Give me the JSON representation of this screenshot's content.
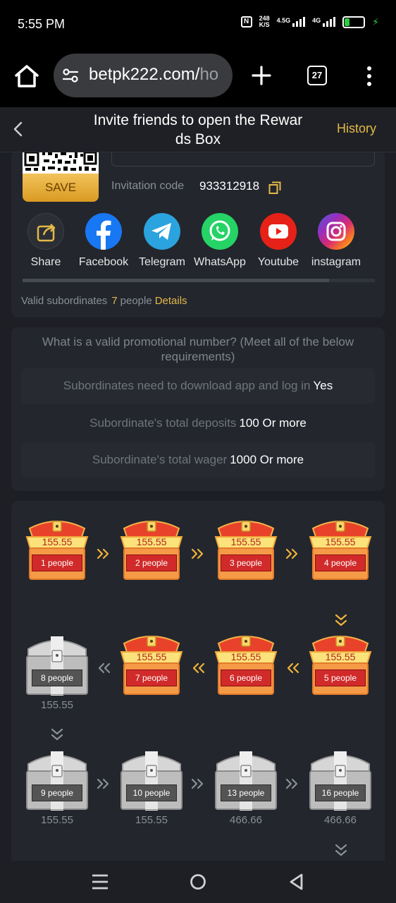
{
  "status_bar": {
    "time": "5:55 PM",
    "speed_value": "248",
    "speed_unit": "K/S",
    "signal1": "4.5G",
    "signal2": "4G",
    "battery": "28",
    "battery_percent": 28
  },
  "browser": {
    "url_main": "betpk222.com/",
    "url_rest": "ho",
    "tab_count": "27"
  },
  "header": {
    "title_line1": "Invite friends to open the Rewar",
    "title_line2": "ds Box",
    "history_label": "History"
  },
  "invite": {
    "save_label": "SAVE",
    "code_label": "Invitation code",
    "code_value": "933312918",
    "share_items": [
      {
        "label": "Share",
        "icon": "share-icon",
        "color": "#2b2e35"
      },
      {
        "label": "Facebook",
        "icon": "facebook-icon",
        "color": "#1877f2"
      },
      {
        "label": "Telegram",
        "icon": "telegram-icon",
        "color": "#2aa3de"
      },
      {
        "label": "WhatsApp",
        "icon": "whatsapp-icon",
        "color": "#25d366"
      },
      {
        "label": "Youtube",
        "icon": "youtube-icon",
        "color": "#e62117"
      },
      {
        "label": "instagram",
        "icon": "instagram-icon",
        "color": "#d62976"
      }
    ],
    "share_scroll_fraction": 0.87,
    "valid_label": "Valid subordinates",
    "valid_count": "7",
    "valid_unit": "people",
    "details_label": "Details"
  },
  "requirements": {
    "title": "What is a valid promotional number? (Meet all of the below requirements)",
    "rows": [
      {
        "label": "Subordinates need to download app and log in",
        "value": "Yes"
      },
      {
        "label": "Subordinate's total deposits",
        "value": "100 Or more"
      },
      {
        "label": "Subordinate's total wager",
        "value": "1000 Or more"
      }
    ]
  },
  "chests": [
    {
      "people": "1 people",
      "amount": "155.55",
      "opened": true
    },
    {
      "people": "2 people",
      "amount": "155.55",
      "opened": true
    },
    {
      "people": "3 people",
      "amount": "155.55",
      "opened": true
    },
    {
      "people": "4 people",
      "amount": "155.55",
      "opened": true
    },
    {
      "people": "5 people",
      "amount": "155.55",
      "opened": true
    },
    {
      "people": "6 people",
      "amount": "155.55",
      "opened": true
    },
    {
      "people": "7 people",
      "amount": "155.55",
      "opened": true
    },
    {
      "people": "8 people",
      "amount": "155.55",
      "opened": false
    },
    {
      "people": "9 people",
      "amount": "155.55",
      "opened": false
    },
    {
      "people": "10 people",
      "amount": "155.55",
      "opened": false
    },
    {
      "people": "13 people",
      "amount": "466.66",
      "opened": false
    },
    {
      "people": "16 people",
      "amount": "466.66",
      "opened": false
    }
  ],
  "colors": {
    "accent": "#e3b948",
    "background": "#1d1f25",
    "card": "#23262d"
  }
}
